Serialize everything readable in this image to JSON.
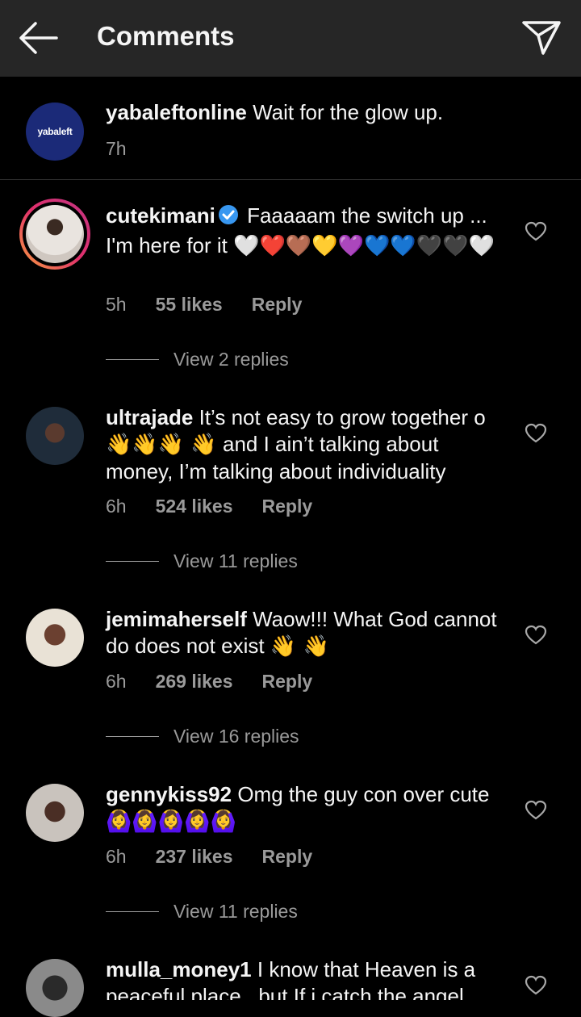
{
  "header": {
    "title": "Comments"
  },
  "caption": {
    "avatar_text": "yabaleft",
    "username": "yabaleftonline",
    "text": "Wait for the glow up.",
    "time": "7h"
  },
  "comments": [
    {
      "username": "cutekimani",
      "text": "Faaaaam the switch up ... I'm here for it",
      "emoji": "🤍❤️🤎💛💜💙💙🖤🖤🤍",
      "time": "5h",
      "likes": "55 likes",
      "reply": "Reply",
      "view_replies": "View 2 replies"
    },
    {
      "username": "ultrajade",
      "text_pre": "It’s not easy to grow together o",
      "emoji": "👋👋👋 👋",
      "text_post": "and I ain’t talking about money, I’m talking about individuality",
      "time": "6h",
      "likes": "524 likes",
      "reply": "Reply",
      "view_replies": "View 11 replies"
    },
    {
      "username": "jemimaherself",
      "text": "Waow!!! What God cannot do does not exist",
      "emoji": "👋 👋",
      "time": "6h",
      "likes": "269 likes",
      "reply": "Reply",
      "view_replies": "View 16 replies"
    },
    {
      "username": "gennykiss92",
      "text": "Omg the guy con over cute",
      "emoji": "🙆‍♀️🙆‍♀️🙆‍♀️🙆‍♀️🙆‍♀️",
      "time": "6h",
      "likes": "237 likes",
      "reply": "Reply",
      "view_replies": "View 11 replies"
    },
    {
      "username": "mulla_money1",
      "text": "I know that Heaven is a peaceful place.. but If i catch the angel"
    }
  ]
}
